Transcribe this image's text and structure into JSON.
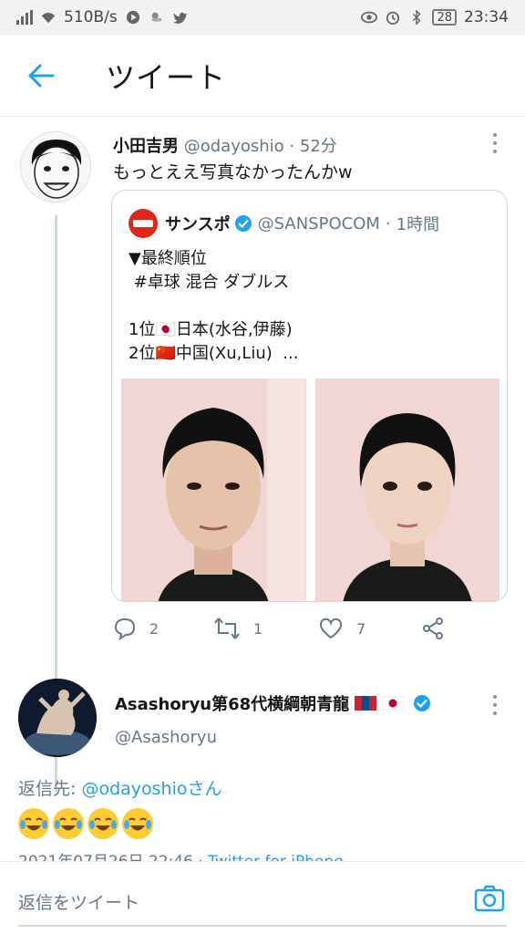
{
  "status_bar": {
    "speed": "510B/s",
    "battery": "28",
    "time": "23:34"
  },
  "header": {
    "title": "ツイート"
  },
  "tweet": {
    "name": "小田吉男",
    "handle": "@odayoshio",
    "separator": "·",
    "time": "52分",
    "text": "もっとええ写真なかったんかw",
    "quote": {
      "name": "サンスポ",
      "handle": "@SANSPOCOM",
      "separator": "·",
      "time": "1時間",
      "text": "▼最終順位\n #卓球 混合 ダブルス\n\n1位🇯🇵日本(水谷,伊藤)\n2位🇨🇳中国(Xu,Liu)  ...",
      "images": [
        "photo-left",
        "photo-right"
      ]
    },
    "actions": {
      "replies": "2",
      "retweets": "1",
      "likes": "7"
    }
  },
  "reply": {
    "name": "Asashoryu第68代横綱朝青龍",
    "handle": "@Asashoryu",
    "reply_to_prefix": "返信先: ",
    "reply_to_handle": "@odayoshioさん",
    "emojis": [
      "😂",
      "😂",
      "😂",
      "😂"
    ],
    "meta_date": "2021年07月26日 22:46 · ",
    "meta_source": "Twitter for iPhone"
  },
  "composer": {
    "placeholder": "返信をツイート"
  },
  "colors": {
    "accent": "#1da1f2",
    "muted": "#657786",
    "border": "#ccd6dd"
  }
}
